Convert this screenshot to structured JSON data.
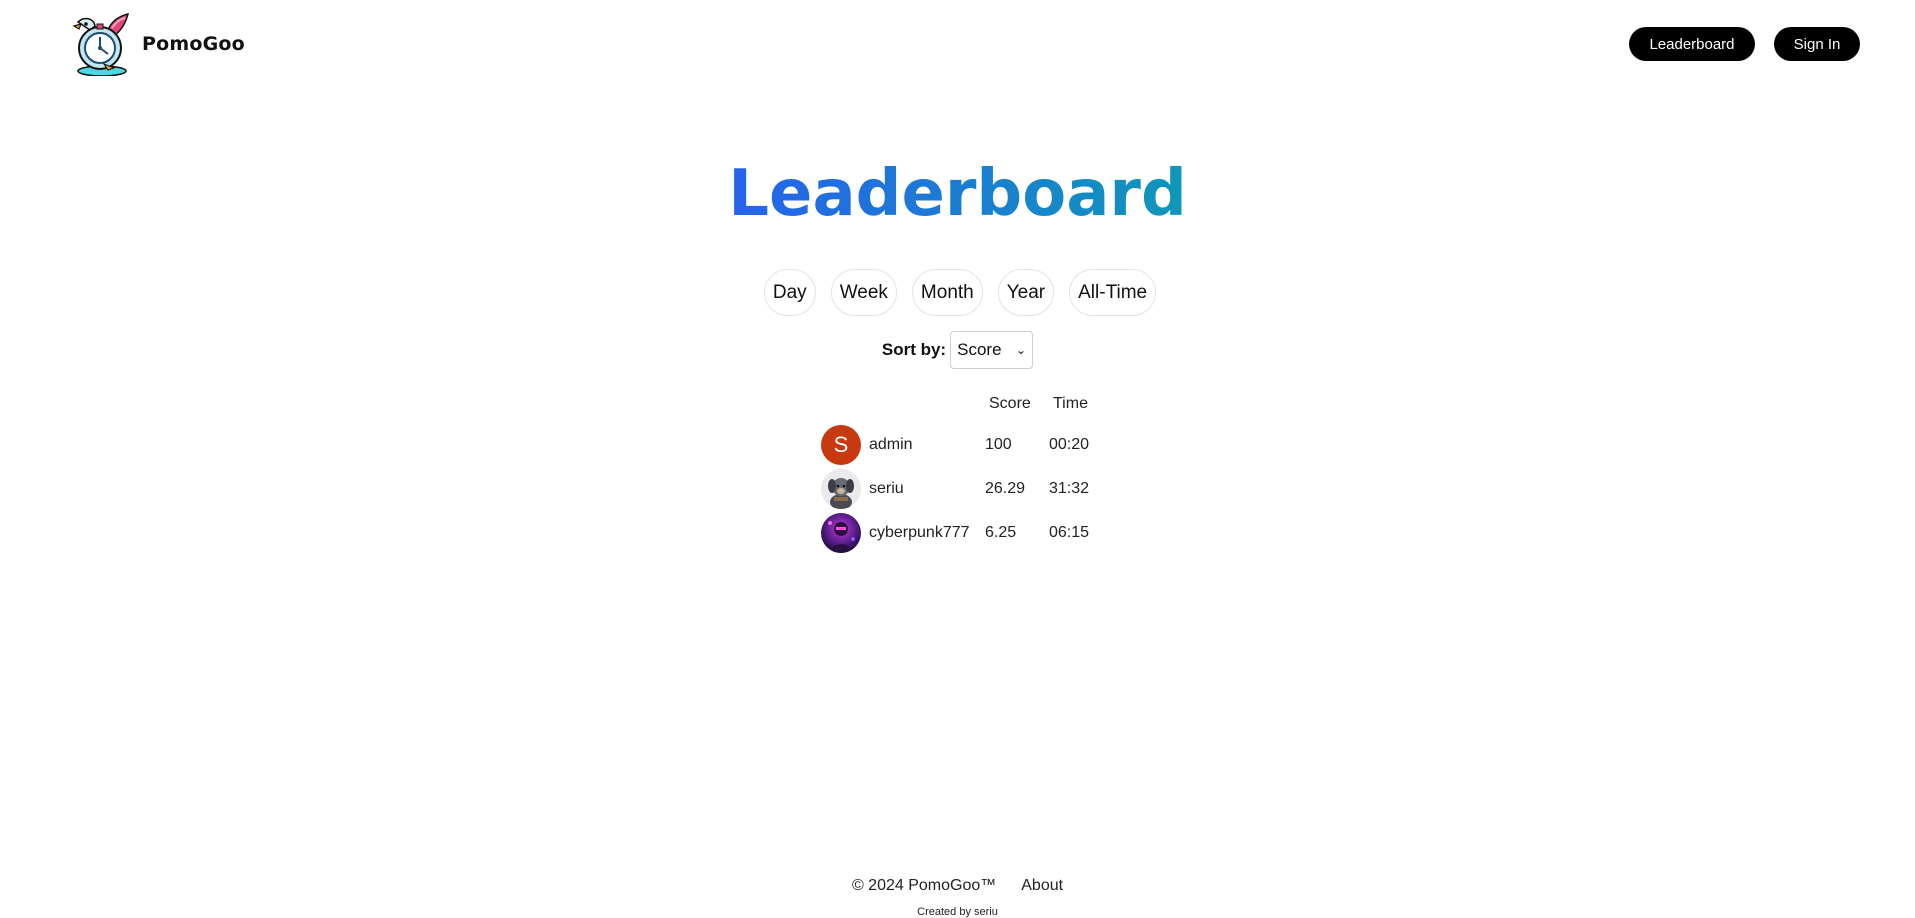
{
  "header": {
    "brand_name": "PomoGoo",
    "logo_icon": "stopwatch-bird-logo",
    "nav": {
      "leaderboard_label": "Leaderboard",
      "signin_label": "Sign In"
    }
  },
  "main": {
    "title": "Leaderboard",
    "title_gradient": [
      "#2563eb",
      "#0e97b8"
    ],
    "periods": [
      "Day",
      "Week",
      "Month",
      "Year",
      "All-Time"
    ],
    "sort": {
      "label": "Sort by:",
      "selected": "Score"
    },
    "table": {
      "headers": {
        "score": "Score",
        "time": "Time"
      },
      "rows": [
        {
          "name": "admin",
          "score": "100",
          "time": "00:20",
          "avatar_letter": "S",
          "avatar_color": "#c8390f"
        },
        {
          "name": "seriu",
          "score": "26.29",
          "time": "31:32",
          "avatar_icon": "dog-photo-avatar"
        },
        {
          "name": "cyberpunk777",
          "score": "6.25",
          "time": "06:15",
          "avatar_icon": "cyberpunk-photo-avatar"
        }
      ]
    }
  },
  "footer": {
    "copyright": "© 2024 PomoGoo™",
    "about_label": "About",
    "credit": "Created by seriu"
  }
}
